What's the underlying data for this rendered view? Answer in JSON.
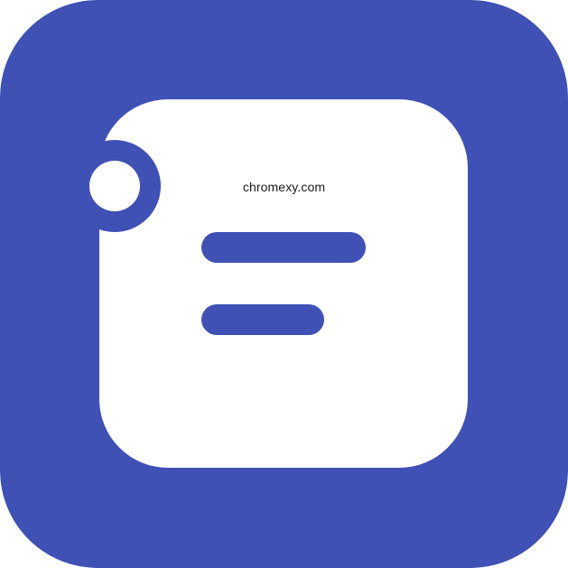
{
  "colors": {
    "brand_blue": "#3f51b5",
    "card_white": "#ffffff"
  },
  "icon": {
    "name": "notes-app-icon"
  },
  "watermark": {
    "text": "chromexy.com"
  }
}
